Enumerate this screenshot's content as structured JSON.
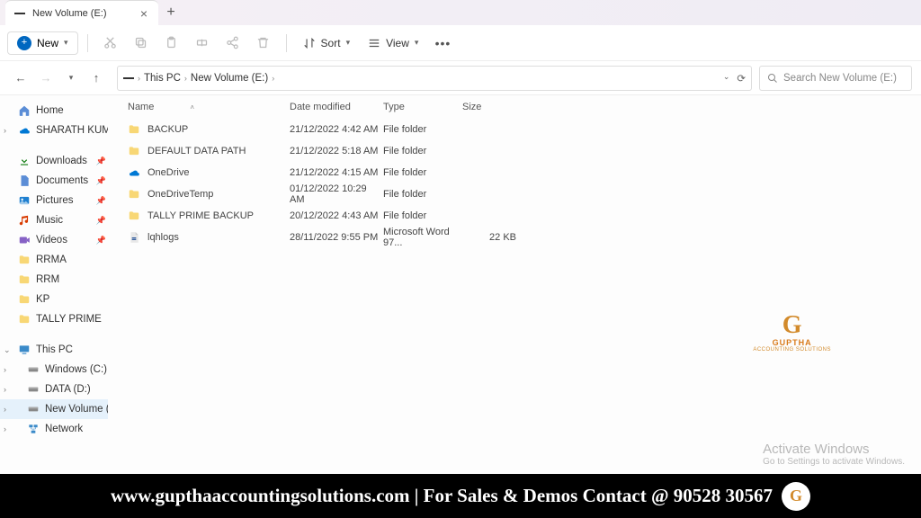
{
  "tab": {
    "title": "New Volume (E:)"
  },
  "toolbar": {
    "new_label": "New",
    "sort_label": "Sort",
    "view_label": "View"
  },
  "address": {
    "crumbs": [
      "This PC",
      "New Volume (E:)"
    ]
  },
  "search": {
    "placeholder": "Search New Volume (E:)"
  },
  "sidebar": {
    "home": "Home",
    "user": "SHARATH KUMAR",
    "quick": [
      {
        "label": "Downloads",
        "pinned": true,
        "icon": "download"
      },
      {
        "label": "Documents",
        "pinned": true,
        "icon": "document"
      },
      {
        "label": "Pictures",
        "pinned": true,
        "icon": "pictures"
      },
      {
        "label": "Music",
        "pinned": true,
        "icon": "music"
      },
      {
        "label": "Videos",
        "pinned": true,
        "icon": "videos"
      },
      {
        "label": "RRMA",
        "pinned": false,
        "icon": "folder"
      },
      {
        "label": "RRM",
        "pinned": false,
        "icon": "folder"
      },
      {
        "label": "KP",
        "pinned": false,
        "icon": "folder"
      },
      {
        "label": "TALLY PRIME",
        "pinned": false,
        "icon": "folder"
      }
    ],
    "this_pc": "This PC",
    "drives": [
      {
        "label": "Windows (C:)",
        "icon": "drive"
      },
      {
        "label": "DATA (D:)",
        "icon": "drive"
      },
      {
        "label": "New Volume (E:)",
        "selected": true,
        "icon": "drive"
      },
      {
        "label": "Network",
        "icon": "network"
      }
    ]
  },
  "columns": {
    "name": "Name",
    "date": "Date modified",
    "type": "Type",
    "size": "Size"
  },
  "files": [
    {
      "name": "BACKUP",
      "date": "21/12/2022 4:42 AM",
      "type": "File folder",
      "size": "",
      "icon": "folder"
    },
    {
      "name": "DEFAULT DATA PATH",
      "date": "21/12/2022 5:18 AM",
      "type": "File folder",
      "size": "",
      "icon": "folder"
    },
    {
      "name": "OneDrive",
      "date": "21/12/2022 4:15 AM",
      "type": "File folder",
      "size": "",
      "icon": "onedrive"
    },
    {
      "name": "OneDriveTemp",
      "date": "01/12/2022 10:29 AM",
      "type": "File folder",
      "size": "",
      "icon": "folder"
    },
    {
      "name": "TALLY PRIME BACKUP",
      "date": "20/12/2022 4:43 AM",
      "type": "File folder",
      "size": "",
      "icon": "folder"
    },
    {
      "name": "lqhlogs",
      "date": "28/11/2022 9:55 PM",
      "type": "Microsoft Word 97...",
      "size": "22 KB",
      "icon": "doc"
    }
  ],
  "watermark": {
    "title": "GUPTHA",
    "subtitle": "ACCOUNTING SOLUTIONS"
  },
  "activate": {
    "line1": "Activate Windows",
    "line2": "Go to Settings to activate Windows."
  },
  "footer": {
    "text": "www.gupthaaccountingsolutions.com | For Sales & Demos Contact @ 90528 30567"
  }
}
